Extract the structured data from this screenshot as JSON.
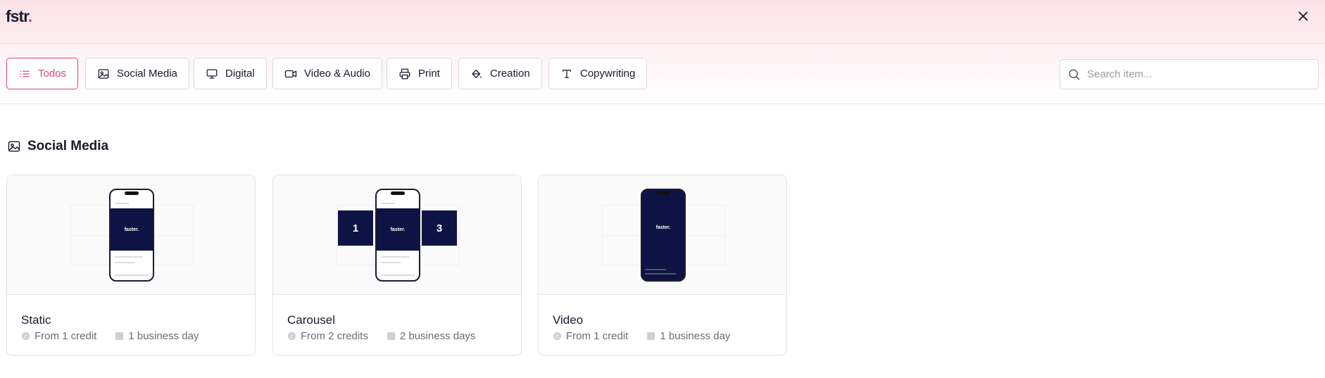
{
  "header": {
    "logo_text": "fstr",
    "logo_dot": "."
  },
  "filters": [
    {
      "label": "Todos",
      "icon": "list-icon",
      "active": true
    },
    {
      "label": "Social Media",
      "icon": "image-icon",
      "active": false
    },
    {
      "label": "Digital",
      "icon": "monitor-icon",
      "active": false
    },
    {
      "label": "Video & Audio",
      "icon": "video-icon",
      "active": false
    },
    {
      "label": "Print",
      "icon": "printer-icon",
      "active": false
    },
    {
      "label": "Creation",
      "icon": "paint-bucket-icon",
      "active": false
    },
    {
      "label": "Copywriting",
      "icon": "type-icon",
      "active": false
    }
  ],
  "search": {
    "placeholder": "Search item...",
    "value": ""
  },
  "section": {
    "title": "Social Media",
    "icon": "image-icon"
  },
  "cards": [
    {
      "title": "Static",
      "credits": "From 1 credit",
      "days": "1 business day",
      "brand": "faster."
    },
    {
      "title": "Carousel",
      "credits": "From 2 credits",
      "days": "2 business days",
      "brand": "faster.",
      "left_num": "1",
      "right_num": "3"
    },
    {
      "title": "Video",
      "credits": "From 1 credit",
      "days": "1 business day",
      "brand": "faster."
    }
  ],
  "colors": {
    "accent": "#e0457b",
    "navy": "#0d1445",
    "border": "#d9d9de"
  }
}
